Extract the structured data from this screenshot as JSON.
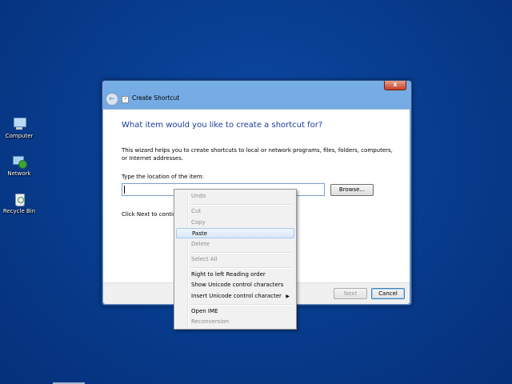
{
  "desktop": {
    "icons": [
      {
        "label": "Computer",
        "icon": "computer-icon"
      },
      {
        "label": "Network",
        "icon": "network-icon"
      },
      {
        "label": "Recycle Bin",
        "icon": "recycle-bin-icon"
      }
    ]
  },
  "window": {
    "title": "Create Shortcut",
    "close_label": "x",
    "back_label": "←",
    "heading": "What item would you like to create a shortcut for?",
    "description": "This wizard helps you to create shortcuts to local or network programs, files, folders, computers, or Internet addresses.",
    "location_label": "Type the location of the item:",
    "location_value": "",
    "browse_label": "Browse...",
    "hint_text": "Click Next to continue.",
    "next_label": "Next",
    "cancel_label": "Cancel"
  },
  "context_menu": {
    "items": [
      {
        "label": "Undo",
        "disabled": true
      },
      {
        "label": "Cut",
        "disabled": true
      },
      {
        "label": "Copy",
        "disabled": true
      },
      {
        "label": "Paste",
        "disabled": false,
        "highlighted": true
      },
      {
        "label": "Delete",
        "disabled": true
      },
      {
        "label": "Select All",
        "disabled": true
      },
      {
        "label": "Right to left Reading order",
        "disabled": false
      },
      {
        "label": "Show Unicode control characters",
        "disabled": false
      },
      {
        "label": "Insert Unicode control character",
        "disabled": false,
        "submenu": true
      },
      {
        "label": "Open IME",
        "disabled": false
      },
      {
        "label": "Reconversion",
        "disabled": true
      }
    ]
  },
  "colors": {
    "desktop": "#0a3d8f",
    "heading": "#1a3b9a",
    "title_bar": "#6ea0dc"
  }
}
